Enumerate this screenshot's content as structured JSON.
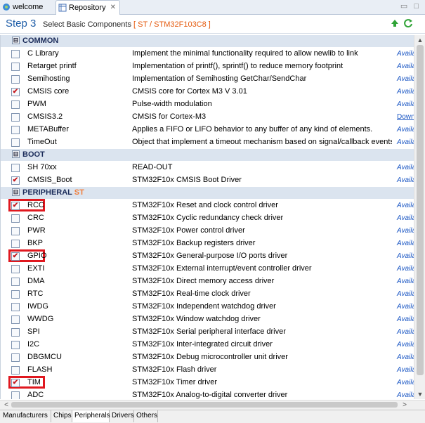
{
  "tabs": [
    {
      "label": "welcome"
    },
    {
      "label": "Repository",
      "close": "✕"
    }
  ],
  "window_controls": "▭ □",
  "header": {
    "step": "Step 3",
    "subtitle": "Select Basic Components",
    "chip": "[ ST / STM32F103C8 ]",
    "up_icon": "up-arrow-icon",
    "refresh_icon": "refresh-icon"
  },
  "rows": [
    {
      "type": "group",
      "expand": "⊟",
      "name": "COMMON"
    },
    {
      "type": "item",
      "checked": false,
      "name": "C Library",
      "desc": "Implement the minimal functionality required to allow newlib to link",
      "status": "Availa"
    },
    {
      "type": "item",
      "checked": false,
      "name": "Retarget printf",
      "desc": "Implementation of printf(), sprintf() to reduce memory footprint",
      "status": "Availa"
    },
    {
      "type": "item",
      "checked": false,
      "name": "Semihosting",
      "desc": "Implementation of Semihosting GetChar/SendChar",
      "status": "Availa"
    },
    {
      "type": "item",
      "checked": true,
      "name": "CMSIS core",
      "desc": "CMSIS core for Cortex M3 V 3.01",
      "status": "Availa"
    },
    {
      "type": "item",
      "checked": false,
      "name": "PWM",
      "desc": "Pulse-width modulation",
      "status": "Availa"
    },
    {
      "type": "item",
      "checked": false,
      "name": "CMSIS3.2",
      "desc": "CMSIS for Cortex-M3",
      "status": "Downl",
      "link": true
    },
    {
      "type": "item",
      "checked": false,
      "name": "METABuffer",
      "desc": "Applies a FIFO or LIFO behavior to any buffer of any kind of elements.",
      "status": "Availa"
    },
    {
      "type": "item",
      "checked": false,
      "name": "TimeOut",
      "desc": "Object that implement a timeout mechanism based on signal/callback events. Usefu...",
      "status": "Availa"
    },
    {
      "type": "group",
      "expand": "⊟",
      "name": "BOOT"
    },
    {
      "type": "item",
      "checked": false,
      "name": "SH 70xx",
      "desc": "READ-OUT",
      "status": "Availa"
    },
    {
      "type": "item",
      "checked": true,
      "name": "CMSIS_Boot",
      "desc": "STM32F10x CMSIS Boot Driver",
      "status": "Availa"
    },
    {
      "type": "group",
      "expand": "⊟",
      "name": "PERIPHERAL",
      "chip": "ST"
    },
    {
      "type": "item",
      "checked": true,
      "highlight": true,
      "name": "RCC",
      "desc": "STM32F10x Reset and clock control driver",
      "status": "Availa"
    },
    {
      "type": "item",
      "checked": false,
      "name": "CRC",
      "desc": "STM32F10x Cyclic redundancy check driver",
      "status": "Availa"
    },
    {
      "type": "item",
      "checked": false,
      "name": "PWR",
      "desc": "STM32F10x Power control driver",
      "status": "Availa"
    },
    {
      "type": "item",
      "checked": false,
      "name": "BKP",
      "desc": "STM32F10x Backup registers driver",
      "status": "Availa"
    },
    {
      "type": "item",
      "checked": true,
      "highlight": true,
      "name": "GPIO",
      "desc": "STM32F10x General-purpose I/O ports driver",
      "status": "Availa"
    },
    {
      "type": "item",
      "checked": false,
      "name": "EXTI",
      "desc": "STM32F10x External interrupt/event controller driver",
      "status": "Availa"
    },
    {
      "type": "item",
      "checked": false,
      "name": "DMA",
      "desc": "STM32F10x Direct memory access driver",
      "status": "Availa"
    },
    {
      "type": "item",
      "checked": false,
      "name": "RTC",
      "desc": "STM32F10x Real-time clock driver",
      "status": "Availa"
    },
    {
      "type": "item",
      "checked": false,
      "name": "IWDG",
      "desc": "STM32F10x Independent watchdog driver",
      "status": "Availa"
    },
    {
      "type": "item",
      "checked": false,
      "name": "WWDG",
      "desc": "STM32F10x Window watchdog driver",
      "status": "Availa"
    },
    {
      "type": "item",
      "checked": false,
      "name": "SPI",
      "desc": "STM32F10x Serial peripheral interface driver",
      "status": "Availa"
    },
    {
      "type": "item",
      "checked": false,
      "name": "I2C",
      "desc": "STM32F10x Inter-integrated circuit driver",
      "status": "Availa"
    },
    {
      "type": "item",
      "checked": false,
      "name": "DBGMCU",
      "desc": "STM32F10x Debug microcontroller unit driver",
      "status": "Availa"
    },
    {
      "type": "item",
      "checked": false,
      "name": "FLASH",
      "desc": "STM32F10x Flash driver",
      "status": "Availa"
    },
    {
      "type": "item",
      "checked": true,
      "highlight": true,
      "name": "TIM",
      "desc": "STM32F10x Timer driver",
      "status": "Availa"
    },
    {
      "type": "item",
      "checked": false,
      "name": "ADC",
      "desc": "STM32F10x Analog-to-digital converter driver",
      "status": "Availa"
    }
  ],
  "scrollbars": {
    "up": "▲",
    "down": "▼",
    "left": "<",
    "right": ">"
  },
  "bottom_tabs": [
    {
      "label": "Manufacturers"
    },
    {
      "label": "Chips"
    },
    {
      "label": "Peripherals",
      "active": true
    },
    {
      "label": "Drivers"
    },
    {
      "label": "Others"
    }
  ],
  "check_glyph": "✔",
  "colors": {
    "accent": "#1f5ea8",
    "chip": "#e55a0d",
    "highlight": "#e0181f",
    "check": "#c4161c",
    "status": "#1a56c4",
    "group_bg": "#dbe4ef"
  }
}
